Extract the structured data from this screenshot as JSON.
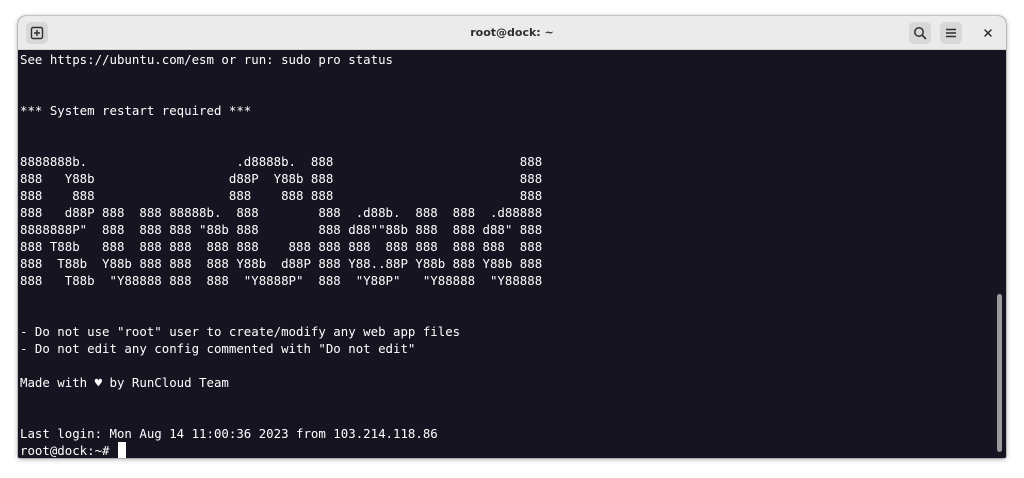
{
  "window": {
    "title": "root@dock: ~"
  },
  "titlebar": {
    "new_tab_icon": "new-tab-icon",
    "search_icon": "search-icon",
    "menu_icon": "hamburger-menu-icon",
    "close_icon": "close-icon"
  },
  "terminal": {
    "lines": [
      "See https://ubuntu.com/esm or run: sudo pro status",
      "",
      "",
      "*** System restart required ***",
      "",
      "",
      "8888888b.                    .d8888b.  888                         888",
      "888   Y88b                  d88P  Y88b 888                         888",
      "888    888                  888    888 888                         888",
      "888   d88P 888  888 88888b.  888        888  .d88b.  888  888  .d88888",
      "8888888P\"  888  888 888 \"88b 888        888 d88\"\"88b 888  888 d88\" 888",
      "888 T88b   888  888 888  888 888    888 888 888  888 888  888 888  888",
      "888  T88b  Y88b 888 888  888 Y88b  d88P 888 Y88..88P Y88b 888 Y88b 888",
      "888   T88b  \"Y88888 888  888  \"Y8888P\"  888  \"Y88P\"   \"Y88888  \"Y88888",
      "",
      "",
      "- Do not use \"root\" user to create/modify any web app files",
      "- Do not edit any config commented with \"Do not edit\"",
      "",
      "Made with ♥ by RunCloud Team",
      "",
      "",
      "Last login: Mon Aug 14 11:00:36 2023 from 103.214.118.86"
    ],
    "prompt": "root@dock:~# "
  },
  "colors": {
    "terminal_bg": "#171421",
    "terminal_fg": "#ffffff",
    "titlebar_bg": "#ebebeb"
  }
}
